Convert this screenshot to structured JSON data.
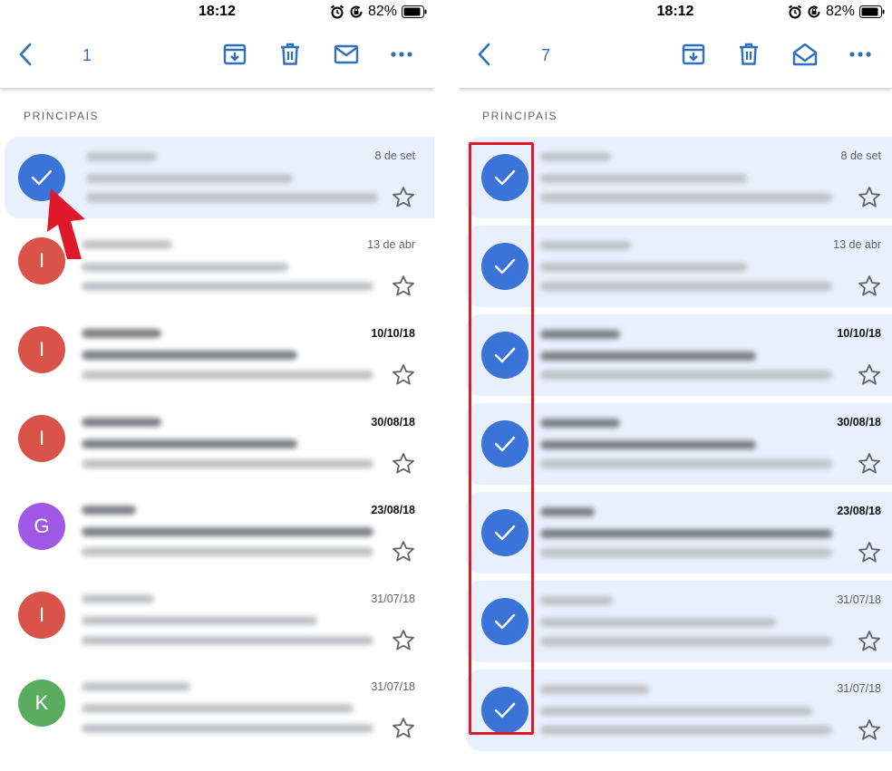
{
  "status_bar": {
    "time": "18:12",
    "battery": "82%"
  },
  "left": {
    "selected_count": "1",
    "section": "PRINCIPAIS",
    "rows": [
      {
        "avatar": "",
        "date": "8 de set",
        "selected": true,
        "unread": false
      },
      {
        "avatar": "I",
        "date": "13 de abr",
        "selected": false,
        "unread": false
      },
      {
        "avatar": "I",
        "date": "10/10/18",
        "selected": false,
        "unread": true
      },
      {
        "avatar": "I",
        "date": "30/08/18",
        "selected": false,
        "unread": true
      },
      {
        "avatar": "G",
        "date": "23/08/18",
        "selected": false,
        "unread": true
      },
      {
        "avatar": "I",
        "date": "31/07/18",
        "selected": false,
        "unread": false
      },
      {
        "avatar": "K",
        "date": "31/07/18",
        "selected": false,
        "unread": false
      }
    ]
  },
  "right": {
    "selected_count": "7",
    "section": "PRINCIPAIS",
    "rows": [
      {
        "date": "8 de set",
        "unread": false
      },
      {
        "date": "13 de abr",
        "unread": false
      },
      {
        "date": "10/10/18",
        "unread": true
      },
      {
        "date": "30/08/18",
        "unread": true
      },
      {
        "date": "23/08/18",
        "unread": true
      },
      {
        "date": "31/07/18",
        "unread": false
      },
      {
        "date": "31/07/18",
        "unread": false
      }
    ]
  },
  "icons": {
    "back": "chevron-left-icon",
    "archive": "archive-icon",
    "delete": "trash-icon",
    "mark_unread": "mail-icon",
    "mark_read": "mail-open-icon",
    "more": "more-horizontal-icon",
    "star": "star-outline-icon",
    "check": "check-icon"
  },
  "colors": {
    "accent": "#2e6fbf",
    "selected_row": "#e8f0fd",
    "check_avatar": "#3b73d8",
    "avatar_I": "#d9534a",
    "avatar_G": "#a158e6",
    "avatar_K": "#5aab5f",
    "highlight": "#e0192a"
  }
}
